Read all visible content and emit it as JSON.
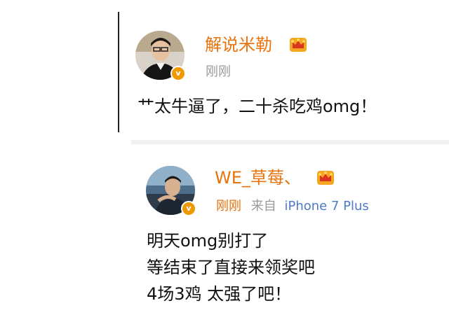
{
  "comments": [
    {
      "username": "解说米勒",
      "timestamp": "刚刚",
      "text": "艹太牛逼了，二十杀吃鸡omg！",
      "verified_badge": "v",
      "crown_icon": "vip-crown-icon"
    },
    {
      "username": "WE_草莓、",
      "timestamp": "刚刚",
      "source_prefix": "来自",
      "source_device": "iPhone 7 Plus",
      "text_lines": [
        "明天omg别打了",
        "等结束了直接来领奖吧",
        "4场3鸡 太强了吧！"
      ],
      "verified_badge": "v",
      "crown_icon": "vip-crown-icon"
    }
  ],
  "colors": {
    "username": "#e8720c",
    "badge": "#f19900",
    "source_link": "#4f7ac8",
    "meta": "#999999",
    "text": "#111111"
  }
}
